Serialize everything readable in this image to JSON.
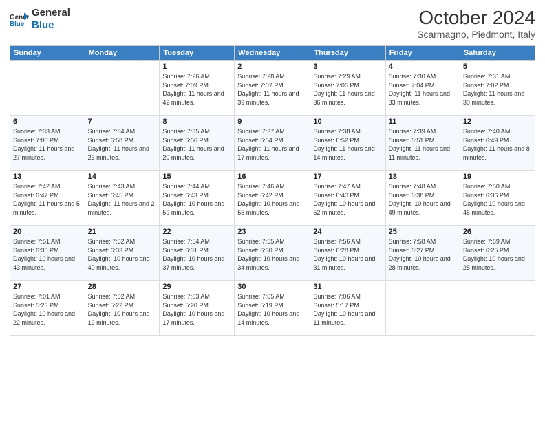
{
  "logo": {
    "line1": "General",
    "line2": "Blue"
  },
  "title": "October 2024",
  "subtitle": "Scarmagno, Piedmont, Italy",
  "days_header": [
    "Sunday",
    "Monday",
    "Tuesday",
    "Wednesday",
    "Thursday",
    "Friday",
    "Saturday"
  ],
  "weeks": [
    [
      {
        "day": "",
        "sunrise": "",
        "sunset": "",
        "daylight": ""
      },
      {
        "day": "",
        "sunrise": "",
        "sunset": "",
        "daylight": ""
      },
      {
        "day": "1",
        "sunrise": "Sunrise: 7:26 AM",
        "sunset": "Sunset: 7:09 PM",
        "daylight": "Daylight: 11 hours and 42 minutes."
      },
      {
        "day": "2",
        "sunrise": "Sunrise: 7:28 AM",
        "sunset": "Sunset: 7:07 PM",
        "daylight": "Daylight: 11 hours and 39 minutes."
      },
      {
        "day": "3",
        "sunrise": "Sunrise: 7:29 AM",
        "sunset": "Sunset: 7:05 PM",
        "daylight": "Daylight: 11 hours and 36 minutes."
      },
      {
        "day": "4",
        "sunrise": "Sunrise: 7:30 AM",
        "sunset": "Sunset: 7:04 PM",
        "daylight": "Daylight: 11 hours and 33 minutes."
      },
      {
        "day": "5",
        "sunrise": "Sunrise: 7:31 AM",
        "sunset": "Sunset: 7:02 PM",
        "daylight": "Daylight: 11 hours and 30 minutes."
      }
    ],
    [
      {
        "day": "6",
        "sunrise": "Sunrise: 7:33 AM",
        "sunset": "Sunset: 7:00 PM",
        "daylight": "Daylight: 11 hours and 27 minutes."
      },
      {
        "day": "7",
        "sunrise": "Sunrise: 7:34 AM",
        "sunset": "Sunset: 6:58 PM",
        "daylight": "Daylight: 11 hours and 23 minutes."
      },
      {
        "day": "8",
        "sunrise": "Sunrise: 7:35 AM",
        "sunset": "Sunset: 6:56 PM",
        "daylight": "Daylight: 11 hours and 20 minutes."
      },
      {
        "day": "9",
        "sunrise": "Sunrise: 7:37 AM",
        "sunset": "Sunset: 6:54 PM",
        "daylight": "Daylight: 11 hours and 17 minutes."
      },
      {
        "day": "10",
        "sunrise": "Sunrise: 7:38 AM",
        "sunset": "Sunset: 6:52 PM",
        "daylight": "Daylight: 11 hours and 14 minutes."
      },
      {
        "day": "11",
        "sunrise": "Sunrise: 7:39 AM",
        "sunset": "Sunset: 6:51 PM",
        "daylight": "Daylight: 11 hours and 11 minutes."
      },
      {
        "day": "12",
        "sunrise": "Sunrise: 7:40 AM",
        "sunset": "Sunset: 6:49 PM",
        "daylight": "Daylight: 11 hours and 8 minutes."
      }
    ],
    [
      {
        "day": "13",
        "sunrise": "Sunrise: 7:42 AM",
        "sunset": "Sunset: 6:47 PM",
        "daylight": "Daylight: 11 hours and 5 minutes."
      },
      {
        "day": "14",
        "sunrise": "Sunrise: 7:43 AM",
        "sunset": "Sunset: 6:45 PM",
        "daylight": "Daylight: 11 hours and 2 minutes."
      },
      {
        "day": "15",
        "sunrise": "Sunrise: 7:44 AM",
        "sunset": "Sunset: 6:43 PM",
        "daylight": "Daylight: 10 hours and 59 minutes."
      },
      {
        "day": "16",
        "sunrise": "Sunrise: 7:46 AM",
        "sunset": "Sunset: 6:42 PM",
        "daylight": "Daylight: 10 hours and 55 minutes."
      },
      {
        "day": "17",
        "sunrise": "Sunrise: 7:47 AM",
        "sunset": "Sunset: 6:40 PM",
        "daylight": "Daylight: 10 hours and 52 minutes."
      },
      {
        "day": "18",
        "sunrise": "Sunrise: 7:48 AM",
        "sunset": "Sunset: 6:38 PM",
        "daylight": "Daylight: 10 hours and 49 minutes."
      },
      {
        "day": "19",
        "sunrise": "Sunrise: 7:50 AM",
        "sunset": "Sunset: 6:36 PM",
        "daylight": "Daylight: 10 hours and 46 minutes."
      }
    ],
    [
      {
        "day": "20",
        "sunrise": "Sunrise: 7:51 AM",
        "sunset": "Sunset: 6:35 PM",
        "daylight": "Daylight: 10 hours and 43 minutes."
      },
      {
        "day": "21",
        "sunrise": "Sunrise: 7:52 AM",
        "sunset": "Sunset: 6:33 PM",
        "daylight": "Daylight: 10 hours and 40 minutes."
      },
      {
        "day": "22",
        "sunrise": "Sunrise: 7:54 AM",
        "sunset": "Sunset: 6:31 PM",
        "daylight": "Daylight: 10 hours and 37 minutes."
      },
      {
        "day": "23",
        "sunrise": "Sunrise: 7:55 AM",
        "sunset": "Sunset: 6:30 PM",
        "daylight": "Daylight: 10 hours and 34 minutes."
      },
      {
        "day": "24",
        "sunrise": "Sunrise: 7:56 AM",
        "sunset": "Sunset: 6:28 PM",
        "daylight": "Daylight: 10 hours and 31 minutes."
      },
      {
        "day": "25",
        "sunrise": "Sunrise: 7:58 AM",
        "sunset": "Sunset: 6:27 PM",
        "daylight": "Daylight: 10 hours and 28 minutes."
      },
      {
        "day": "26",
        "sunrise": "Sunrise: 7:59 AM",
        "sunset": "Sunset: 6:25 PM",
        "daylight": "Daylight: 10 hours and 25 minutes."
      }
    ],
    [
      {
        "day": "27",
        "sunrise": "Sunrise: 7:01 AM",
        "sunset": "Sunset: 5:23 PM",
        "daylight": "Daylight: 10 hours and 22 minutes."
      },
      {
        "day": "28",
        "sunrise": "Sunrise: 7:02 AM",
        "sunset": "Sunset: 5:22 PM",
        "daylight": "Daylight: 10 hours and 19 minutes."
      },
      {
        "day": "29",
        "sunrise": "Sunrise: 7:03 AM",
        "sunset": "Sunset: 5:20 PM",
        "daylight": "Daylight: 10 hours and 17 minutes."
      },
      {
        "day": "30",
        "sunrise": "Sunrise: 7:05 AM",
        "sunset": "Sunset: 5:19 PM",
        "daylight": "Daylight: 10 hours and 14 minutes."
      },
      {
        "day": "31",
        "sunrise": "Sunrise: 7:06 AM",
        "sunset": "Sunset: 5:17 PM",
        "daylight": "Daylight: 10 hours and 11 minutes."
      },
      {
        "day": "",
        "sunrise": "",
        "sunset": "",
        "daylight": ""
      },
      {
        "day": "",
        "sunrise": "",
        "sunset": "",
        "daylight": ""
      }
    ]
  ]
}
